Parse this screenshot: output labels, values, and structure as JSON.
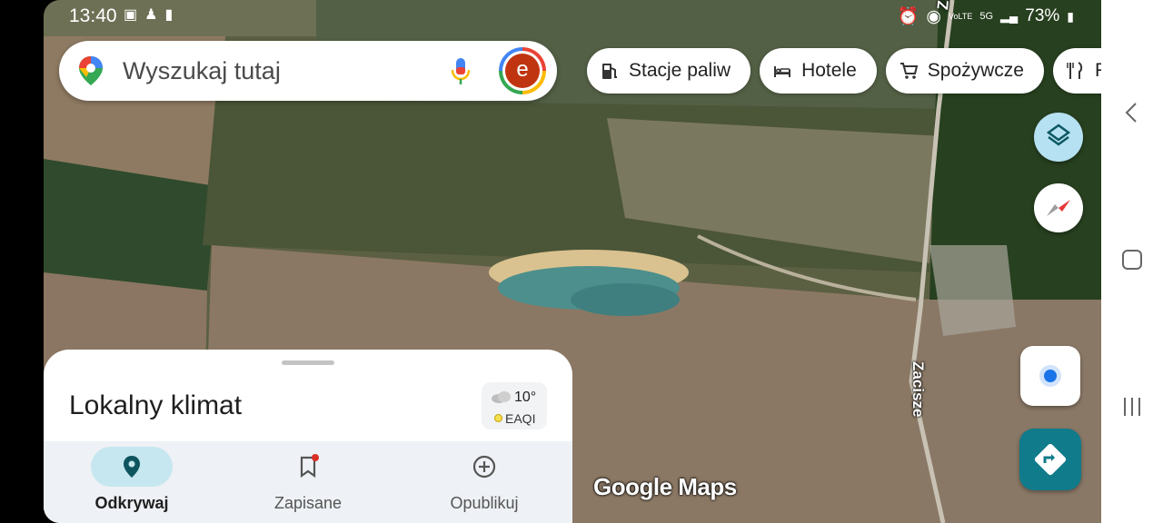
{
  "statusbar": {
    "time": "13:40",
    "battery": "73%",
    "notification_icons": [
      "image-icon",
      "person-icon",
      "clipboard-icon"
    ],
    "system_icons": [
      "alarm-icon",
      "location-icon",
      "volte-icon",
      "5g-icon",
      "signal-icon",
      "battery-icon"
    ]
  },
  "search": {
    "placeholder": "Wyszukaj tutaj",
    "avatar_initial": "e"
  },
  "chips": [
    {
      "label": "Stacje paliw",
      "icon": "gas-station-icon"
    },
    {
      "label": "Hotele",
      "icon": "bed-icon"
    },
    {
      "label": "Spożywcze",
      "icon": "cart-icon"
    },
    {
      "label": "R",
      "icon": "restaurant-icon"
    }
  ],
  "map": {
    "street_labels": [
      "Zacisze",
      "Zacisze"
    ],
    "watermark": "Google Maps"
  },
  "sheet": {
    "title": "Lokalny klimat",
    "weather": {
      "temperature": "10°",
      "air_quality": "EAQI"
    }
  },
  "tabs": [
    {
      "label": "Odkrywaj",
      "active": true
    },
    {
      "label": "Zapisane",
      "active": false,
      "badge": true
    },
    {
      "label": "Opublikuj",
      "active": false
    }
  ],
  "colors": {
    "accent": "#107b8a",
    "active_tab_pill": "#c6e7f0",
    "avatar_bg": "#c0340f"
  }
}
